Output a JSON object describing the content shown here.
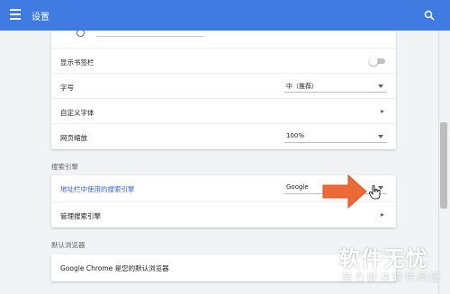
{
  "header": {
    "title": "设置",
    "menu_icon": "menu-icon",
    "search_icon": "search-icon",
    "color": "#3f7be0"
  },
  "appearance": {
    "show_bookmarks_bar": {
      "label": "显示书签栏",
      "enabled": false
    },
    "font_size": {
      "label": "字号",
      "value": "中（推荐）"
    },
    "custom_fonts": {
      "label": "自定义字体"
    },
    "page_zoom": {
      "label": "网页缩放",
      "value": "100%"
    }
  },
  "search_engine": {
    "section_title": "搜索引擎",
    "address_bar": {
      "label": "地址栏中使用的搜索引擎",
      "value": "Google"
    },
    "manage": {
      "label": "管理搜索引擎"
    }
  },
  "default_browser": {
    "section_title": "默认浏览器",
    "status": "Google Chrome 是您的默认浏览器"
  },
  "watermark": {
    "title": "软件无忧",
    "subtitle": "努力解决软件问题"
  }
}
